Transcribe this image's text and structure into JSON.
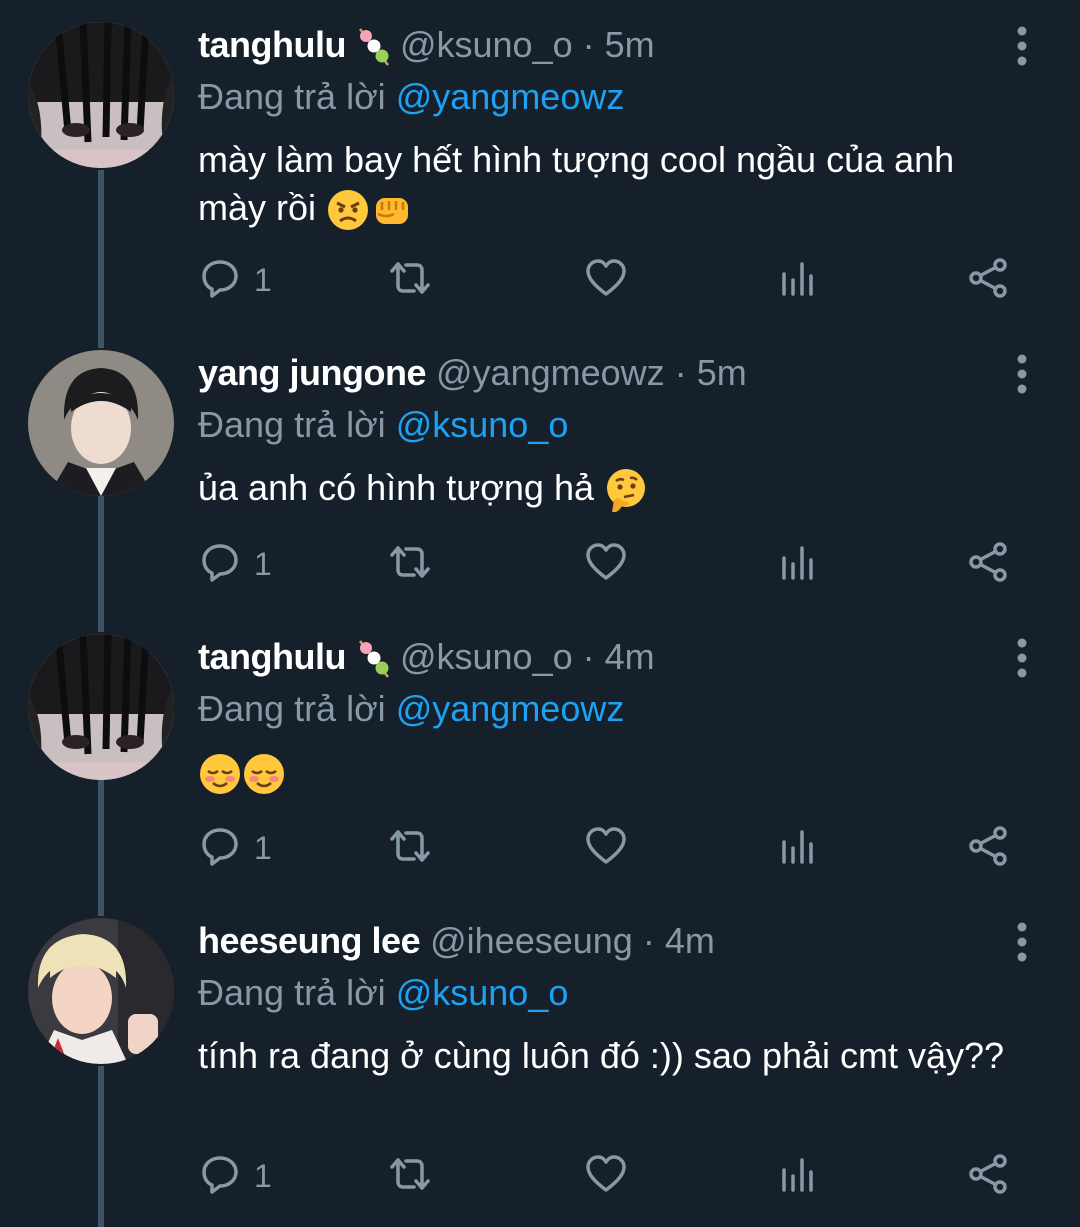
{
  "reply_prefix": "Đang trả lời",
  "tweets": [
    {
      "name": "tanghulu",
      "name_emoji": "tanghulu-skewer-icon",
      "handle": "@ksuno_o",
      "dot": "·",
      "time": "5m",
      "reply_to": "@yangmeowz",
      "text": "mày làm bay hết hình tượng cool ngầu của anh mày rồi",
      "text_emojis": [
        "angry-face-icon",
        "fist-icon"
      ],
      "reply_count": "1"
    },
    {
      "name": "yang jungone",
      "handle": "@yangmeowz",
      "dot": "·",
      "time": "5m",
      "reply_to": "@ksuno_o",
      "text": "ủa anh có hình tượng hả",
      "text_emojis": [
        "thinking-face-icon"
      ],
      "reply_count": "1"
    },
    {
      "name": "tanghulu",
      "name_emoji": "tanghulu-skewer-icon",
      "handle": "@ksuno_o",
      "dot": "·",
      "time": "4m",
      "reply_to": "@yangmeowz",
      "text": "",
      "text_emojis": [
        "smiling-face-icon",
        "smiling-face-icon"
      ],
      "reply_count": "1"
    },
    {
      "name": "heeseung lee",
      "handle": "@iheeseung",
      "dot": "·",
      "time": "4m",
      "reply_to": "@ksuno_o",
      "text": "tính ra đang ở cùng luôn đó :)) sao phải cmt vậy??",
      "text_emojis": [],
      "reply_count": "1"
    }
  ],
  "colors": {
    "background": "#15202b",
    "secondary_text": "#8899a6",
    "mention": "#1da1f2",
    "thread_line": "#3d5466"
  }
}
